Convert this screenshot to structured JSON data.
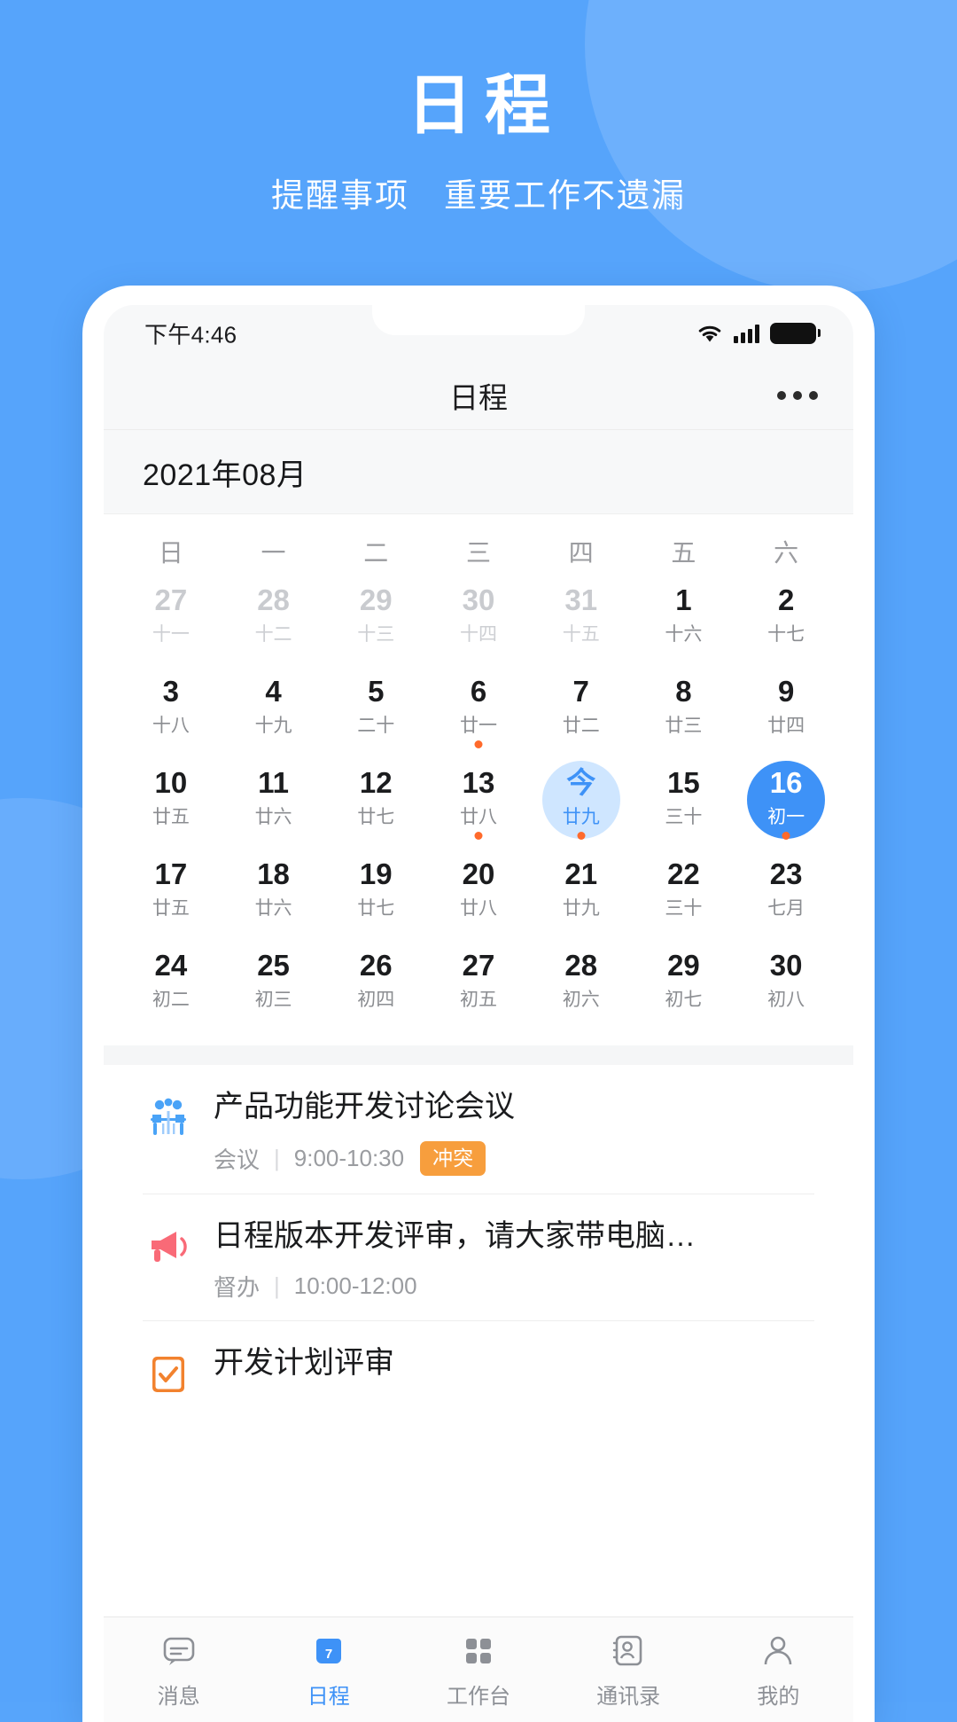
{
  "promo": {
    "title": "日程",
    "subtitle": "提醒事项　重要工作不遗漏",
    "bg_color": "#56a4fb"
  },
  "statusbar": {
    "time": "下午4:46",
    "wifi_icon": "wifi-icon",
    "signal_icon": "cellular-signal-icon",
    "battery_icon": "battery-icon"
  },
  "navbar": {
    "title": "日程",
    "more_icon": "more-horizontal-icon"
  },
  "calendar": {
    "month_label": "2021年08月",
    "weekdays": [
      "日",
      "一",
      "二",
      "三",
      "四",
      "五",
      "六"
    ],
    "accent_color": "#3e92f7",
    "today_bg": "#cfe6ff",
    "dot_color": "#ff6a2b",
    "days": [
      {
        "d": "27",
        "l": "十一",
        "out": true
      },
      {
        "d": "28",
        "l": "十二",
        "out": true
      },
      {
        "d": "29",
        "l": "十三",
        "out": true
      },
      {
        "d": "30",
        "l": "十四",
        "out": true
      },
      {
        "d": "31",
        "l": "十五",
        "out": true
      },
      {
        "d": "1",
        "l": "十六"
      },
      {
        "d": "2",
        "l": "十七"
      },
      {
        "d": "3",
        "l": "十八"
      },
      {
        "d": "4",
        "l": "十九"
      },
      {
        "d": "5",
        "l": "二十"
      },
      {
        "d": "6",
        "l": "廿一",
        "dot": true
      },
      {
        "d": "7",
        "l": "廿二"
      },
      {
        "d": "8",
        "l": "廿三"
      },
      {
        "d": "9",
        "l": "廿四"
      },
      {
        "d": "10",
        "l": "廿五"
      },
      {
        "d": "11",
        "l": "廿六"
      },
      {
        "d": "12",
        "l": "廿七"
      },
      {
        "d": "13",
        "l": "廿八",
        "dot": true
      },
      {
        "d": "今",
        "l": "廿九",
        "today": true,
        "dot": true
      },
      {
        "d": "15",
        "l": "三十"
      },
      {
        "d": "16",
        "l": "初一",
        "selected": true,
        "dot": true
      },
      {
        "d": "17",
        "l": "廿五"
      },
      {
        "d": "18",
        "l": "廿六"
      },
      {
        "d": "19",
        "l": "廿七"
      },
      {
        "d": "20",
        "l": "廿八"
      },
      {
        "d": "21",
        "l": "廿九"
      },
      {
        "d": "22",
        "l": "三十"
      },
      {
        "d": "23",
        "l": "七月"
      },
      {
        "d": "24",
        "l": "初二"
      },
      {
        "d": "25",
        "l": "初三"
      },
      {
        "d": "26",
        "l": "初四"
      },
      {
        "d": "27",
        "l": "初五"
      },
      {
        "d": "28",
        "l": "初六"
      },
      {
        "d": "29",
        "l": "初七"
      },
      {
        "d": "30",
        "l": "初八"
      }
    ]
  },
  "events": [
    {
      "icon": "meeting-people-icon",
      "title": "产品功能开发讨论会议",
      "type": "会议",
      "time": "9:00-10:30",
      "badge": "冲突",
      "badge_color": "#f79e3d"
    },
    {
      "icon": "megaphone-icon",
      "title": "日程版本开发评审，请大家带电脑…",
      "type": "督办",
      "time": "10:00-12:00",
      "badge": ""
    },
    {
      "icon": "clipboard-check-icon",
      "title": "开发计划评审",
      "type": "",
      "time": "",
      "badge": ""
    }
  ],
  "tabbar": {
    "items": [
      {
        "icon": "message-icon",
        "label": "消息",
        "active": false
      },
      {
        "icon": "calendar-icon",
        "label": "日程",
        "active": true
      },
      {
        "icon": "workbench-grid-icon",
        "label": "工作台",
        "active": false
      },
      {
        "icon": "contacts-icon",
        "label": "通讯录",
        "active": false
      },
      {
        "icon": "profile-person-icon",
        "label": "我的",
        "active": false
      }
    ],
    "calendar_icon_day": "7"
  }
}
